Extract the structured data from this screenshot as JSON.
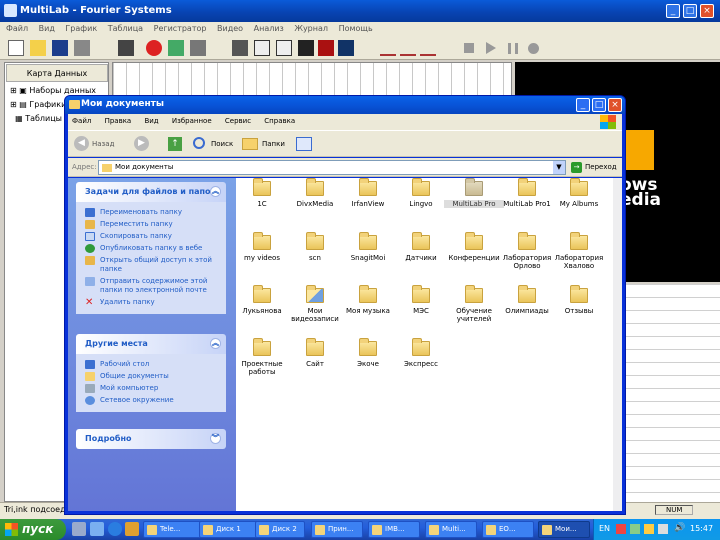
{
  "app": {
    "title": "MultiLab - Fourier Systems",
    "menu": [
      "Файл",
      "Вид",
      "График",
      "Таблица",
      "Регистратор",
      "Видео",
      "Анализ",
      "Журнал",
      "Помощь"
    ],
    "side_header": "Карта Данных",
    "tree": [
      "Наборы данных",
      "Графики",
      "Таблицы"
    ],
    "status_text": "Tri,ink подсоед...",
    "status_num": "NUM",
    "media_text": [
      "ows",
      "edia"
    ]
  },
  "explorer": {
    "title": "Мои документы",
    "menu": [
      "Файл",
      "Правка",
      "Вид",
      "Избранное",
      "Сервис",
      "Справка"
    ],
    "toolbar": {
      "back": "Назад",
      "search": "Поиск",
      "folders": "Папки"
    },
    "address_label": "Адрес:",
    "address_value": "Мои документы",
    "go_label": "Переход",
    "tasks_panel": {
      "title": "Задачи для файлов и папок",
      "items": [
        "Переименовать папку",
        "Переместить папку",
        "Скопировать папку",
        "Опубликовать папку в вебе",
        "Открыть общий доступ к этой папке",
        "Отправить содержимое этой папки по электронной почте",
        "Удалить папку"
      ]
    },
    "places_panel": {
      "title": "Другие места",
      "items": [
        "Рабочий стол",
        "Общие документы",
        "Мой компьютер",
        "Сетевое окружение"
      ]
    },
    "details_panel": {
      "title": "Подробно"
    },
    "folders": [
      "1C",
      "DivxMedia",
      "IrfanView",
      "Lingvo",
      "MultiLab Pro",
      "MultiLab Pro1",
      "My Albums",
      "my videos",
      "scn",
      "SnagitMoi",
      "Датчики",
      "Конференции",
      "Лаборатория Орлово",
      "Лаборатория Хвалово",
      "Лукьянова",
      "Мои видеозаписи",
      "Моя музыка",
      "МЭС",
      "Обучение учителей",
      "Олимпиады",
      "Отзывы",
      "Проектные работы",
      "Сайт",
      "Экоче",
      "Экспресс"
    ],
    "selected_folder": "MultiLab Pro"
  },
  "taskbar": {
    "start_label": "пуск",
    "items": [
      "Tele...",
      "Диск 1",
      "Диск 2",
      "Прин...",
      "IMB...",
      "Multi...",
      "ЕО...",
      "Мои..."
    ],
    "tray_lang": "EN",
    "clock": "15:47"
  }
}
